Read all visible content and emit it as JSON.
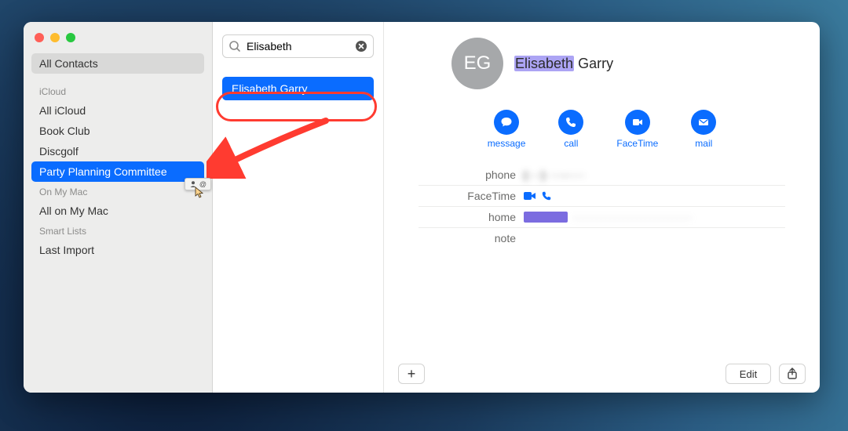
{
  "sidebar": {
    "all_contacts": "All Contacts",
    "sections": [
      {
        "header": "iCloud",
        "items": [
          "All iCloud",
          "Book Club",
          "Discgolf",
          "Party Planning Committee"
        ],
        "selected": 3
      },
      {
        "header": "On My Mac",
        "items": [
          "All on My Mac"
        ],
        "selected": -1
      },
      {
        "header": "Smart Lists",
        "items": [
          "Last Import"
        ],
        "selected": -1
      }
    ]
  },
  "search": {
    "value": "Elisabeth",
    "placeholder": "Search"
  },
  "results": [
    {
      "label": "Elisabeth Garry",
      "selected": true
    }
  ],
  "contact": {
    "initials": "EG",
    "first": "Elisabeth",
    "last": "Garry",
    "actions": [
      {
        "name": "message",
        "label": "message"
      },
      {
        "name": "call",
        "label": "call"
      },
      {
        "name": "facetime",
        "label": "FaceTime"
      },
      {
        "name": "mail",
        "label": "mail"
      }
    ],
    "fields": {
      "phone_key": "phone",
      "phone_val": "(···) ···-····",
      "facetime_key": "FaceTime",
      "home_key": "home",
      "home_val": "···························",
      "note_key": "note"
    }
  },
  "buttons": {
    "add": "+",
    "edit": "Edit"
  }
}
